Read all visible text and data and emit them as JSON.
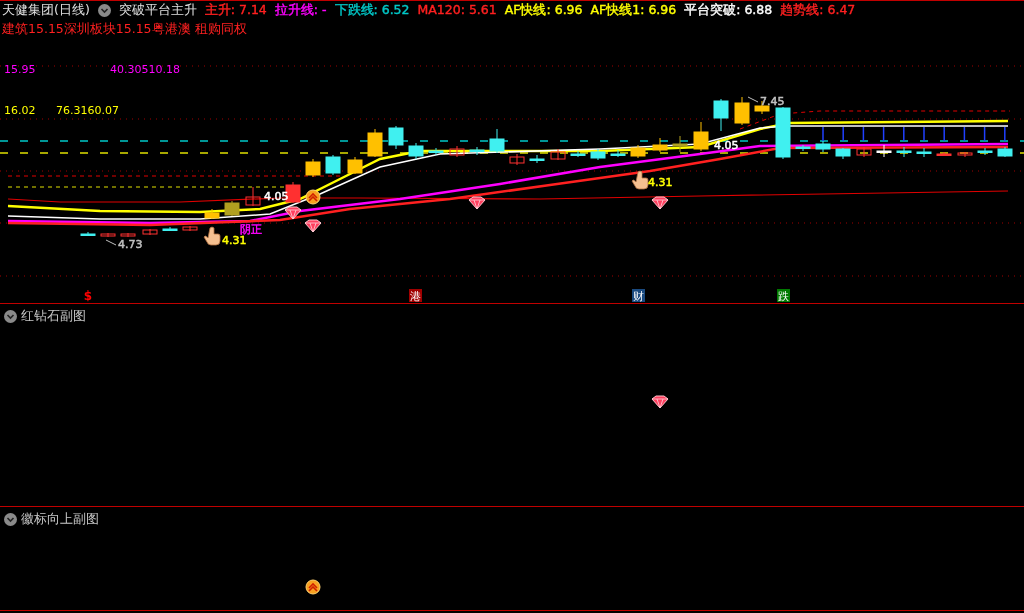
{
  "header": {
    "stock": "天健集团(日线)",
    "indicator": "突破平台主升",
    "values": [
      {
        "text": "主升: 7.14",
        "color": "#ff2020"
      },
      {
        "text": "拉升线: -",
        "color": "#ff00ff"
      },
      {
        "text": "下跌线: 6.52",
        "color": "#00c8c8"
      },
      {
        "text": "MA120: 5.61",
        "color": "#ff2020"
      },
      {
        "text": "AF快线: 6.96",
        "color": "#ffff00"
      },
      {
        "text": "AF快线1: 6.96",
        "color": "#ffff00"
      },
      {
        "text": "平台突破: 6.88",
        "color": "#ffffff"
      },
      {
        "text": "趋势线: 6.47",
        "color": "#ff2020"
      }
    ]
  },
  "concepts": "建筑15.15深圳板块15.15粤港澳 租购同权",
  "main_chart": {
    "axis_labels": [
      {
        "texts": [
          "15.95",
          "40.30510.18"
        ],
        "color": "#ff00ff"
      },
      {
        "texts": [
          "16.02",
          "76.3160.07"
        ],
        "color": "#ffff00"
      }
    ],
    "annotations": [
      {
        "kind": "arrow",
        "text": "4.73",
        "color": "#c0c0c0"
      },
      {
        "kind": "hand",
        "text": "4.31",
        "color": "#ffff00"
      },
      {
        "kind": "plain",
        "text": "4.05",
        "color": "#ffffff"
      },
      {
        "kind": "plain",
        "text": "阴正",
        "color": "#ff00ff"
      },
      {
        "kind": "hand",
        "text": "4.31",
        "color": "#ffff00"
      },
      {
        "kind": "plain",
        "text": "4.05",
        "color": "#ffffff"
      },
      {
        "kind": "arrow",
        "text": "7.45",
        "color": "#c0c0c0"
      }
    ],
    "event_markers": [
      {
        "kind": "plain",
        "text": "$",
        "color": "#ff0000"
      },
      {
        "kind": "tag",
        "text": "港",
        "color": "#a00000"
      },
      {
        "kind": "tag",
        "text": "财",
        "color": "#1a4a80"
      },
      {
        "kind": "tag",
        "text": "跌",
        "color": "#007a00"
      }
    ]
  },
  "panels": [
    {
      "title": "红钻石副图"
    },
    {
      "title": "徽标向上副图"
    }
  ]
}
